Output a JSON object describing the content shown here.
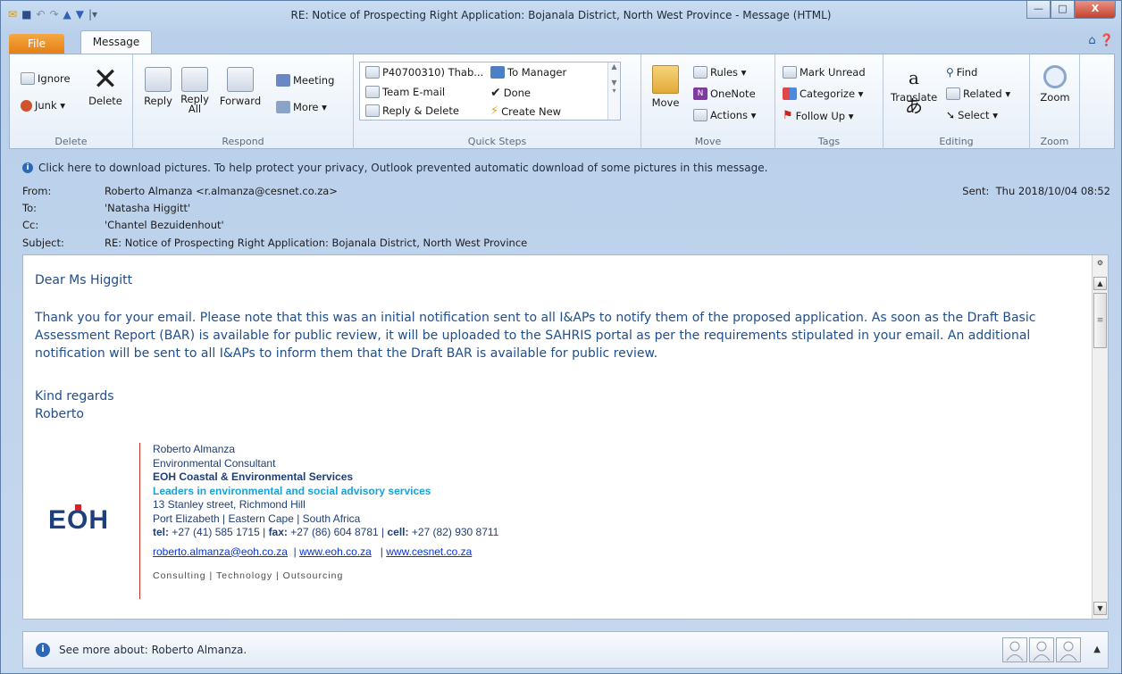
{
  "window": {
    "title": "RE: Notice of Prospecting Right Application: Bojanala District, North West Province  -  Message (HTML)",
    "controls": {
      "minimize": "—",
      "maximize": "□",
      "close": "X"
    }
  },
  "tabs": {
    "file": "File",
    "message": "Message"
  },
  "ribbon": {
    "delete_group": {
      "label": "Delete",
      "ignore": "Ignore",
      "junk": "Junk ▾",
      "delete": "Delete"
    },
    "respond_group": {
      "label": "Respond",
      "reply": "Reply",
      "reply_all": "Reply All",
      "forward": "Forward",
      "meeting": "Meeting",
      "more": "More ▾"
    },
    "quick_steps": {
      "label": "Quick Steps",
      "items": [
        "P40700310) Thab...",
        "To Manager",
        "Team E-mail",
        "Done",
        "Reply & Delete",
        "Create New"
      ]
    },
    "move_group": {
      "label": "Move",
      "move": "Move",
      "rules": "Rules ▾",
      "onenote": "OneNote",
      "actions": "Actions ▾"
    },
    "tags_group": {
      "label": "Tags",
      "mark_unread": "Mark Unread",
      "categorize": "Categorize ▾",
      "follow_up": "Follow Up ▾"
    },
    "editing_group": {
      "label": "Editing",
      "translate": "Translate",
      "find": "Find",
      "related": "Related ▾",
      "select": "Select ▾"
    },
    "zoom_group": {
      "label": "Zoom",
      "zoom": "Zoom"
    }
  },
  "message": {
    "infobar": "Click here to download pictures. To help protect your privacy, Outlook prevented automatic download of some pictures in this message.",
    "from_label": "From:",
    "from": "Roberto Almanza <r.almanza@cesnet.co.za>",
    "to_label": "To:",
    "to": "'Natasha Higgitt'",
    "cc_label": "Cc:",
    "cc": "'Chantel Bezuidenhout'",
    "subject_label": "Subject:",
    "subject": "RE: Notice of Prospecting Right Application: Bojanala District, North West Province",
    "sent_label": "Sent:",
    "sent": "Thu 2018/10/04 08:52"
  },
  "body": {
    "greeting": "Dear Ms Higgitt",
    "para_line1": "Thank you for your email. Please note that this was an initial notification sent to all I&APs to notify them of the proposed application. As soon as the Draft Basic",
    "para_line2": "Assessment Report (BAR) is available for public review, it will be uploaded to the SAHRIS portal as per the requirements stipulated in your email. An additional",
    "para_line3": "notification will be sent to all I&APs to inform them that the Draft BAR is available for public review.",
    "closing": "Kind regards",
    "name": "Roberto"
  },
  "signature": {
    "name": "Roberto Almanza",
    "role": "Environmental Consultant",
    "company": "EOH Coastal & Environmental Services",
    "tagline": "Leaders in environmental and social advisory services",
    "address1": "13 Stanley street, Richmond Hill",
    "address2": "Port Elizabeth  | Eastern Cape  |  South Africa",
    "tel_label": "tel:",
    "tel": "+27 (41) 585 1715 |",
    "fax_label": "fax:",
    "fax": "+27 (86) 604 8781 |",
    "cell_label": "cell:",
    "cell": "+27 (82) 930 8711",
    "email": "roberto.almanza@eoh.co.za",
    "web1": "www.eoh.co.za",
    "web2": "www.cesnet.co.za",
    "footer": "Consulting | Technology | Outsourcing",
    "logo": "EOH"
  },
  "people_pane": {
    "text": "See more about: Roberto Almanza."
  }
}
